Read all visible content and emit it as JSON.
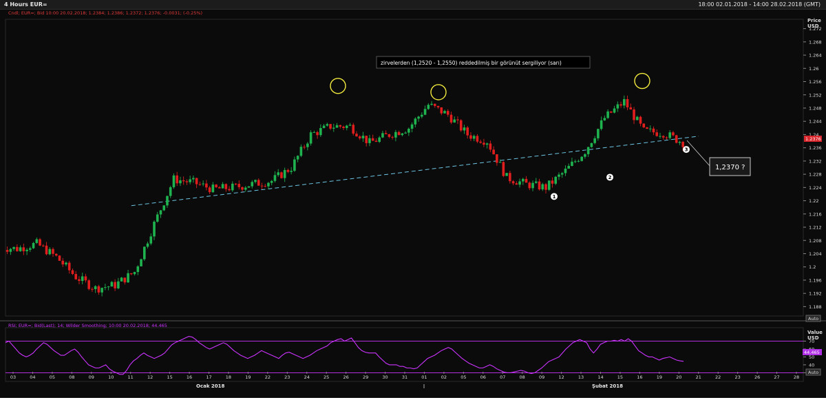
{
  "window": {
    "title": "4 Hours EUR=",
    "range": "18:00 02.01.2018 - 14:00 28.02.2018 (GMT)"
  },
  "price_panel": {
    "legend": "Cndl; EUR=; Bid  10:00 20.02.2018; 1.2384; 1.2386; 1.2372; 1.2376; -0.0031; (-0.25%)",
    "axis_title_1": "Price",
    "axis_title_2": "USD",
    "auto_label": "Auto",
    "last_price_label": "1.2376"
  },
  "rsi_panel": {
    "legend": "RSI; EUR=; Bid(Last);  14; Wilder Smoothing;  10:00 20.02.2018; 44.465",
    "axis_title_1": "Value",
    "axis_title_2": "USD",
    "auto_label": "Auto",
    "last_value_label": "44.465"
  },
  "annotations": {
    "note": "zirvelerden (1,2520 - 1,2550) reddedilmiş bir görünüt sergiliyor (sarı)",
    "target_box": "1,2370 ?",
    "markers": [
      {
        "label": "1",
        "x": 11,
        "y": 1.2213
      },
      {
        "label": "2",
        "x": 14.55,
        "y": 1.2271
      },
      {
        "label": "3",
        "x": 20.45,
        "y": 1.2355
      }
    ],
    "circles": [
      {
        "x": 25.6,
        "y": 1.2547
      },
      {
        "x": 1.3,
        "y": 1.2528
      },
      {
        "x": 16.4,
        "y": 1.2562
      }
    ],
    "trendline": {
      "from": {
        "x": 8.5,
        "y": 1.2185
      },
      "to": {
        "x": 21.25,
        "y": 1.2395
      }
    }
  },
  "colors": {
    "up": "#1fb34f",
    "down": "#e01e1e",
    "rsi": "#cc33ff",
    "annotation_circle": "#f2ea3d",
    "trendline": "#6ec8e6",
    "last_price_bg": "#d8262c",
    "last_rsi_bg": "#b030e6"
  },
  "chart_data": [
    {
      "type": "candlestick",
      "title": "",
      "ylabel": "Price USD",
      "ylim": [
        1.186,
        1.274
      ],
      "yticks": [
        "1.188",
        "1.192",
        "1.196",
        "1.2",
        "1.204",
        "1.208",
        "1.212",
        "1.216",
        "1.22",
        "1.224",
        "1.228",
        "1.232",
        "1.236",
        "1.24",
        "1.244",
        "1.248",
        "1.252",
        "1.256",
        "1.26",
        "1.264",
        "1.268",
        "1.272"
      ],
      "x_ticks": [
        "03",
        "04",
        "05",
        "08",
        "09",
        "10",
        "11",
        "12",
        "15",
        "16",
        "17",
        "18",
        "19",
        "22",
        "23",
        "24",
        "25",
        "26",
        "29",
        "30",
        "31",
        "01",
        "02",
        "05",
        "06",
        "07",
        "08",
        "09",
        "12",
        "13",
        "14",
        "15",
        "16",
        "19",
        "20",
        "21",
        "22",
        "23",
        "26",
        "27",
        "28"
      ],
      "month_labels": [
        {
          "label": "Ocak 2018",
          "at": "03"
        },
        {
          "label": "Şubat 2018",
          "at": "14"
        }
      ],
      "sessions": [
        {
          "day": "03",
          "close": 1.2055
        },
        {
          "day": "04",
          "close": 1.207
        },
        {
          "day": "05",
          "close": 1.203
        },
        {
          "day": "08",
          "close": 1.197
        },
        {
          "day": "09",
          "close": 1.1935
        },
        {
          "day": "10",
          "close": 1.1945
        },
        {
          "day": "11",
          "close": 1.1985
        },
        {
          "day": "12",
          "close": 1.213
        },
        {
          "day": "15",
          "close": 1.2265
        },
        {
          "day": "16",
          "close": 1.2255
        },
        {
          "day": "17",
          "close": 1.2235
        },
        {
          "day": "18",
          "close": 1.224
        },
        {
          "day": "19",
          "close": 1.225
        },
        {
          "day": "22",
          "close": 1.226
        },
        {
          "day": "23",
          "close": 1.23
        },
        {
          "day": "24",
          "close": 1.24
        },
        {
          "day": "25",
          "close": 1.2425
        },
        {
          "day": "26",
          "close": 1.2425
        },
        {
          "day": "29",
          "close": 1.2375
        },
        {
          "day": "30",
          "close": 1.24
        },
        {
          "day": "31",
          "close": 1.242
        },
        {
          "day": "01",
          "close": 1.249
        },
        {
          "day": "02",
          "close": 1.246
        },
        {
          "day": "05",
          "close": 1.24
        },
        {
          "day": "06",
          "close": 1.238
        },
        {
          "day": "07",
          "close": 1.227
        },
        {
          "day": "08",
          "close": 1.225
        },
        {
          "day": "09",
          "close": 1.224
        },
        {
          "day": "12",
          "close": 1.229
        },
        {
          "day": "13",
          "close": 1.235
        },
        {
          "day": "14",
          "close": 1.245
        },
        {
          "day": "15",
          "close": 1.25
        },
        {
          "day": "16",
          "close": 1.241
        },
        {
          "day": "19",
          "close": 1.2405
        },
        {
          "day": "20",
          "close": 1.2376
        }
      ]
    },
    {
      "type": "line",
      "title": "",
      "ylabel": "Value USD",
      "ylim": [
        26,
        80
      ],
      "yticks": [
        "30",
        "40",
        "50",
        "60",
        "70"
      ],
      "reference_lines": [
        30,
        70
      ],
      "series": [
        {
          "name": "RSI",
          "values": [
            68,
            70,
            65,
            60,
            55,
            52,
            50,
            52,
            55,
            60,
            64,
            68,
            66,
            62,
            58,
            55,
            52,
            52,
            55,
            58,
            60,
            56,
            50,
            45,
            40,
            38,
            36,
            36,
            38,
            40,
            35,
            32,
            30,
            28,
            28,
            33,
            40,
            45,
            48,
            52,
            55,
            52,
            50,
            48,
            50,
            52,
            55,
            60,
            65,
            68,
            70,
            72,
            74,
            76,
            75,
            72,
            68,
            65,
            62,
            60,
            62,
            64,
            66,
            68,
            66,
            62,
            58,
            55,
            52,
            50,
            48,
            50,
            52,
            55,
            58,
            56,
            54,
            52,
            50,
            48,
            52,
            55,
            56,
            54,
            52,
            50,
            48,
            50,
            52,
            55,
            58,
            60,
            62,
            64,
            68,
            70,
            72,
            73,
            70,
            72,
            74,
            68,
            62,
            58,
            56,
            55,
            55,
            55,
            50,
            46,
            42,
            40,
            40,
            40,
            38,
            38,
            36,
            36,
            35,
            36,
            40,
            44,
            48,
            50,
            52,
            55,
            58,
            60,
            62,
            60,
            56,
            52,
            48,
            45,
            42,
            40,
            38,
            36,
            36,
            38,
            40,
            38,
            35,
            33,
            31,
            30,
            30,
            31,
            32,
            33,
            32,
            30,
            29,
            30,
            33,
            36,
            40,
            44,
            46,
            48,
            50,
            55,
            60,
            64,
            68,
            70,
            72,
            70,
            68,
            60,
            55,
            60,
            66,
            68,
            70,
            70,
            71,
            70,
            72,
            70,
            73,
            70,
            64,
            58,
            55,
            52,
            50,
            50,
            48,
            46,
            48,
            49,
            50,
            48,
            46,
            45,
            44.465
          ]
        }
      ]
    }
  ]
}
